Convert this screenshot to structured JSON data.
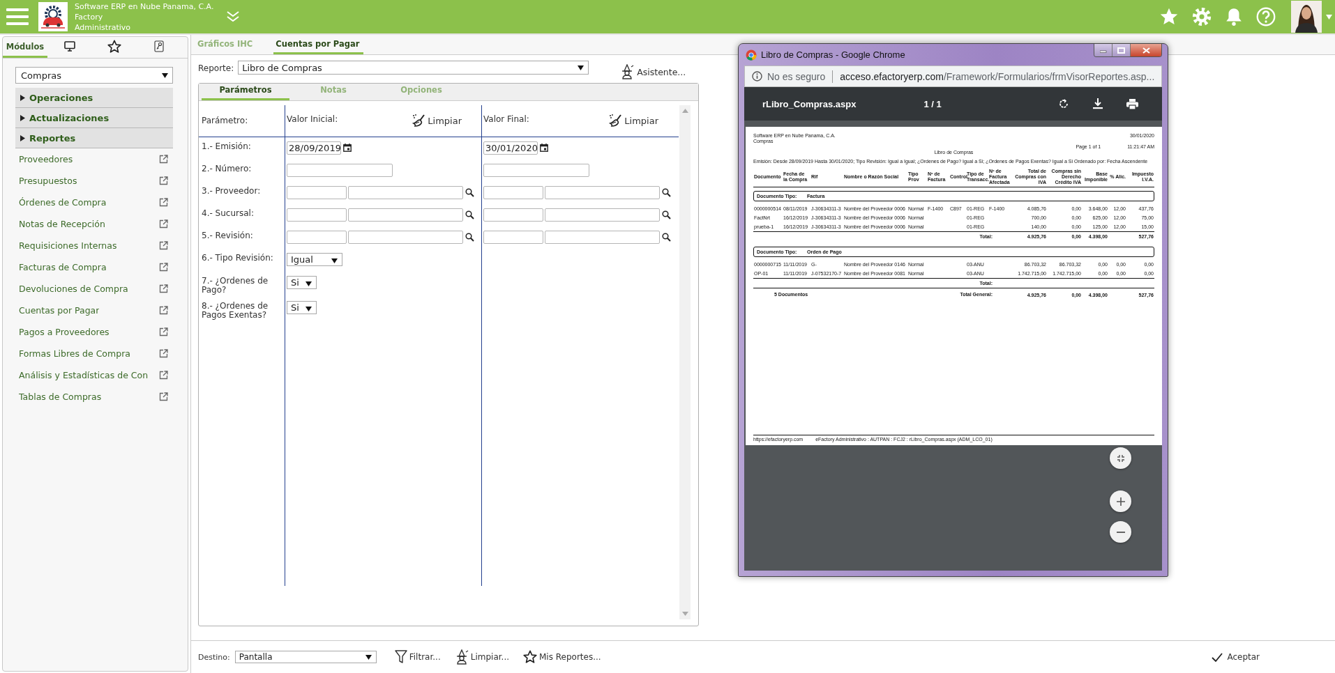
{
  "header": {
    "company": "Software ERP en Nube Panama, C.A.",
    "line_2": "Factory",
    "line_3": "Administrativo"
  },
  "sidebar": {
    "tabs": [
      {
        "kind": "label",
        "label": "Módulos",
        "selected": true
      },
      {
        "kind": "monitor",
        "selected": false
      },
      {
        "kind": "star",
        "selected": false
      },
      {
        "kind": "key",
        "selected": false
      }
    ],
    "module": "Compras",
    "sections": [
      {
        "label": "Operaciones",
        "expanded": false
      },
      {
        "label": "Actualizaciones",
        "expanded": false
      },
      {
        "label": "Reportes",
        "expanded": false
      }
    ],
    "items": [
      "Proveedores",
      "Presupuestos",
      "Órdenes de Compra",
      "Notas de Recepción",
      "Requisiciones Internas",
      "Facturas de Compra",
      "Devoluciones de Compra",
      "Cuentas por Pagar",
      "Pagos a Proveedores",
      "Formas Libres de Compra",
      "Análisis y Estadísticas de Con",
      "Tablas de Compras"
    ]
  },
  "main": {
    "tabs": [
      {
        "label": "Gráficos IHC",
        "selected": false
      },
      {
        "label": "Cuentas por Pagar",
        "selected": true
      }
    ],
    "report_label": "Reporte:",
    "report": "Libro de Compras",
    "assistant": "Asistente...",
    "subtabs": [
      {
        "label": "Parámetros",
        "selected": true
      },
      {
        "label": "Notas",
        "selected": false
      },
      {
        "label": "Opciones",
        "selected": false
      }
    ],
    "param_header": {
      "parameter": "Parámetro:",
      "initial": "Valor Inicial:",
      "clear_initial": "Limpiar",
      "final": "Valor Final:",
      "clear_final": "Limpiar"
    },
    "params": [
      {
        "kind": "date",
        "label": "1.- Emisión:",
        "initial": "28/09/2019",
        "final": "30/01/2020"
      },
      {
        "kind": "text",
        "label": "2.- Número:"
      },
      {
        "kind": "lookup",
        "label": "3.- Proveedor:"
      },
      {
        "kind": "lookup",
        "label": "4.- Sucursal:"
      },
      {
        "kind": "lookup",
        "label": "5.- Revisión:"
      },
      {
        "kind": "select",
        "label": "6.- Tipo Revisión:",
        "initial": "Igual"
      },
      {
        "kind": "select",
        "label": "7.- ¿Ordenes de Pago?",
        "initial": "Si"
      },
      {
        "kind": "select",
        "label": "8.- ¿Ordenes de Pagos Exentas?",
        "initial": "Si"
      }
    ]
  },
  "footer": {
    "destination_label": "Destino:",
    "destination": "Pantalla",
    "actions": [
      {
        "kind": "filter",
        "label": "Filtrar..."
      },
      {
        "kind": "broom",
        "label": "Limpiar..."
      },
      {
        "kind": "star",
        "label": "Mis Reportes..."
      }
    ],
    "accept": "Aceptar"
  },
  "popup": {
    "title": "Libro de Compras - Google Chrome",
    "security": "No es seguro",
    "url_host": "acceso.efactoryerp.com",
    "url_path": "/Framework/Formularios/frmVisorReportes.asp...",
    "pdf_title": "rLibro_Compras.aspx",
    "page": "1 / 1",
    "report": {
      "company": "Software ERP en Nube Panama, C.A.",
      "date": "30/01/2020",
      "module": "Compras",
      "page": "Page 1 of 1",
      "time": "11:21:47 AM",
      "title": "Libro de Compras",
      "filter": "Emisión: Desde 28/09/2019 Hasta 30/01/2020; Tipo Revisión: Igual a Igual; ¿Ordenes de Pago? Igual a Si; ¿Ordenes de Pagos Exentas? Igual a Si Ordenado por: Fecha Ascendente",
      "columns": [
        "Documento",
        "Fecha de la Compra",
        "Rif",
        "Nombre o Razón Social",
        "Tipo Prov",
        "Nº de Factura",
        "Control",
        "Tipo de Transacc.",
        "Nº de Factura Afectada",
        "Total de Compras con IVA",
        "Compras sin Derecho Crédito IVA",
        "Base Imponible",
        "% Alic.",
        "Impuesto I.V.A."
      ],
      "groups": [
        {
          "label": "Documento Tipo:",
          "type": "Factura",
          "total_label": "Total:",
          "rows": [
            [
              "0000000514",
              "08/11/2019",
              "J-30634311-3",
              "Nombre del Proveedor 0006",
              "Normal",
              "F-1400",
              "C897",
              "01-REG",
              "F-1400",
              "4.085,76",
              "0,00",
              "3.648,00",
              "12,00",
              "437,76"
            ],
            [
              "FactNrt",
              "16/12/2019",
              "J-30634311-3",
              "Nombre del Proveedor 0006",
              "Normal",
              null,
              null,
              "01-REG",
              null,
              "700,00",
              "0,00",
              "625,00",
              "12,00",
              "75,00"
            ],
            [
              "prueba-1",
              "16/12/2019",
              "J-30634311-3",
              "Nombre del Proveedor 0006",
              "Normal",
              null,
              null,
              "01-REG",
              null,
              "140,00",
              "0,00",
              "125,00",
              "12,00",
              "15,00"
            ]
          ],
          "totals": [
            "4.925,76",
            "0,00",
            "4.398,00",
            "527,76"
          ]
        },
        {
          "label": "Documento Tipo:",
          "type": "Orden de Pago",
          "total_label": "Total:",
          "rows": [
            [
              "0000000715",
              "11/11/2019",
              "G-",
              "Nombre del Proveedor 0146",
              "Normal",
              null,
              null,
              "03-ANU",
              null,
              "86.703,32",
              "86.703,32",
              "0,00",
              "0,00",
              "0,00"
            ],
            [
              "OP-01",
              "11/11/2019",
              "J-07532170-7",
              "Nombre del Proveedor 0081",
              "Normal",
              null,
              null,
              "03-ANU",
              null,
              "1.742.715,00",
              "1.742.715,00",
              "0,00",
              "0,00",
              "0,00"
            ]
          ]
        }
      ],
      "count": "5 Documentos",
      "grand_label": "Total General:",
      "grand_totals": [
        "4.925,76",
        "0,00",
        "4.398,00",
        "527,76"
      ],
      "footer_url": "https://efactoryerp.com",
      "footer_info": "eFactory Administrativo : AUTPAN : FCJ2 : rLibro_Compras.aspx (ADM_LCO_01)"
    }
  }
}
